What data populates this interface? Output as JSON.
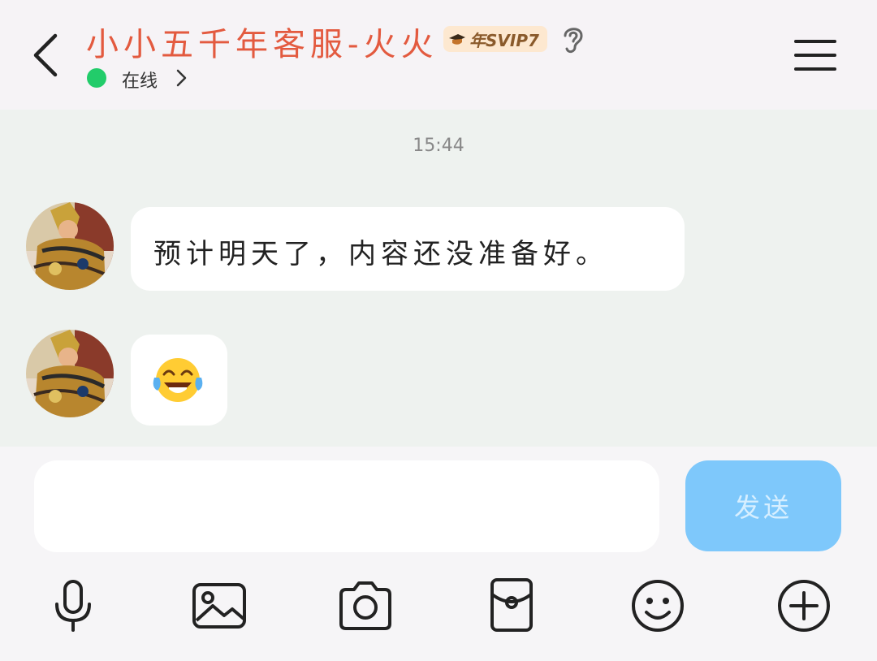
{
  "header": {
    "title": "小小五千年客服-火火",
    "vip_label": "年SVIP7",
    "status": "在线"
  },
  "chat": {
    "timestamp": "15:44",
    "messages": [
      {
        "text": "预计明天了，内容还没准备好。",
        "kind": "text"
      },
      {
        "text": "😂",
        "kind": "emoji"
      }
    ]
  },
  "input": {
    "value": "",
    "placeholder": "",
    "send_label": "发送"
  },
  "toolbar": {
    "icons": [
      "microphone-icon",
      "image-icon",
      "camera-icon",
      "red-packet-icon",
      "emoji-icon",
      "plus-icon"
    ]
  },
  "colors": {
    "title": "#e35a3f",
    "online": "#22cc6a",
    "send_button": "#7ec8fb",
    "chat_bg": "#eef2ef"
  }
}
